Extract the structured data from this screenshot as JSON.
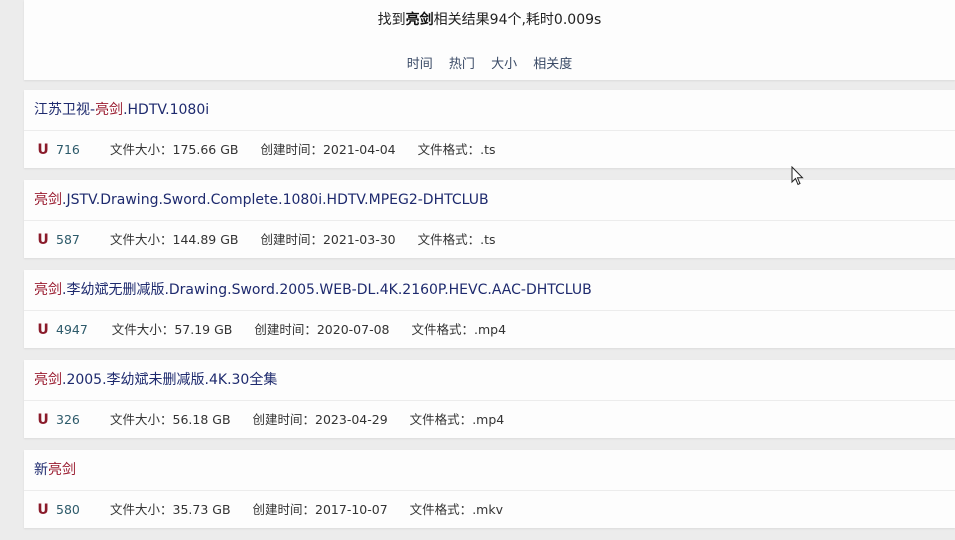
{
  "summary": {
    "prefix": "找到",
    "keyword": "亮剑",
    "suffix": "相关结果94个,耗时0.009s"
  },
  "sort_options": [
    "时间",
    "热门",
    "大小",
    "相关度"
  ],
  "results": [
    {
      "title_keyword": "",
      "title_prefix": "江苏卫视-",
      "title_kw": "亮剑",
      "title_rest": ".HDTV.1080i",
      "hot": "716",
      "size_label": "文件大小：",
      "size": "175.66 GB",
      "date_label": "创建时间：",
      "date": "2021-04-04",
      "format_label": "文件格式：",
      "format": ".ts"
    },
    {
      "title_prefix": "",
      "title_kw": "亮剑",
      "title_rest": ".JSTV.Drawing.Sword.Complete.1080i.HDTV.MPEG2-DHTCLUB",
      "hot": "587",
      "size_label": "文件大小：",
      "size": "144.89 GB",
      "date_label": "创建时间：",
      "date": "2021-03-30",
      "format_label": "文件格式：",
      "format": ".ts"
    },
    {
      "title_prefix": "",
      "title_kw": "亮剑",
      "title_rest": ".李幼斌无删减版.Drawing.Sword.2005.WEB-DL.4K.2160P.HEVC.AAC-DHTCLUB",
      "hot": "4947",
      "size_label": "文件大小：",
      "size": "57.19 GB",
      "date_label": "创建时间：",
      "date": "2020-07-08",
      "format_label": "文件格式：",
      "format": ".mp4"
    },
    {
      "title_prefix": "",
      "title_kw": "亮剑",
      "title_rest": ".2005.李幼斌未删减版.4K.30全集",
      "hot": "326",
      "size_label": "文件大小：",
      "size": "56.18 GB",
      "date_label": "创建时间：",
      "date": "2023-04-29",
      "format_label": "文件格式：",
      "format": ".mp4"
    },
    {
      "title_prefix": "新",
      "title_kw": "亮剑",
      "title_rest": "",
      "hot": "580",
      "size_label": "文件大小：",
      "size": "35.73 GB",
      "date_label": "创建时间：",
      "date": "2017-10-07",
      "format_label": "文件格式：",
      "format": ".mkv"
    }
  ],
  "icons": {
    "hot_icon": "U"
  },
  "colors": {
    "keyword": "#9a1c30",
    "title": "#1e2a6e",
    "hot_icon": "#8a1a2a"
  }
}
